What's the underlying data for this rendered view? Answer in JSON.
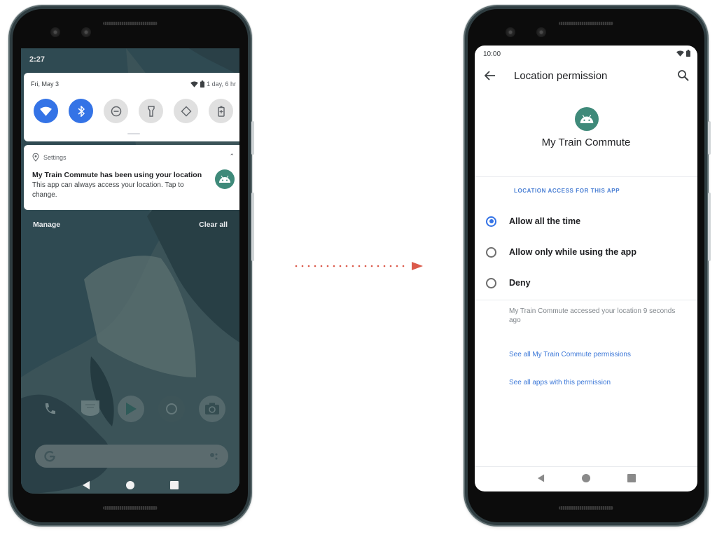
{
  "colors": {
    "accent_blue": "#3473e6",
    "link_blue": "#3c78d8",
    "app_icon_teal": "#3f8a7a",
    "arrow_red": "#db5a4b",
    "wallpaper": "#2f4a52"
  },
  "left_phone": {
    "status_time": "2:27",
    "quick_settings": {
      "date": "Fri, May 3",
      "battery_text": "1 day, 6 hr",
      "tiles": [
        {
          "icon": "wifi-icon",
          "state": "on"
        },
        {
          "icon": "bluetooth-icon",
          "state": "on"
        },
        {
          "icon": "do-not-disturb-icon",
          "state": "off"
        },
        {
          "icon": "flashlight-icon",
          "state": "off"
        },
        {
          "icon": "auto-rotate-icon",
          "state": "off"
        },
        {
          "icon": "battery-saver-icon",
          "state": "off"
        }
      ]
    },
    "notification": {
      "source": "Settings",
      "title": "My Train Commute has been using your location",
      "body": "This app can always access your location. Tap to change.",
      "icon": "android-app-icon"
    },
    "actions": {
      "manage": "Manage",
      "clear_all": "Clear all"
    },
    "dock_icons": [
      "phone-icon",
      "messages-icon",
      "play-store-icon",
      "chrome-icon",
      "camera-icon"
    ],
    "search_bar": {
      "icon_left": "google-g-icon",
      "icon_right": "assistant-icon"
    },
    "nav": [
      "back-icon",
      "home-icon",
      "recents-icon"
    ]
  },
  "right_phone": {
    "status_time": "10:00",
    "appbar": {
      "title": "Location permission",
      "back_icon": "back-arrow-icon",
      "search_icon": "search-icon"
    },
    "app_name": "My Train Commute",
    "section_label": "LOCATION ACCESS FOR THIS APP",
    "options": [
      {
        "label": "Allow all the time",
        "selected": true
      },
      {
        "label": "Allow only while using the app",
        "selected": false
      },
      {
        "label": "Deny",
        "selected": false
      }
    ],
    "access_note": "My Train Commute accessed your location 9 seconds ago",
    "links": {
      "app_permissions": "See all My Train Commute permissions",
      "apps_with_permission": "See all apps with this permission"
    },
    "nav": [
      "back-icon",
      "home-icon",
      "recents-icon"
    ]
  }
}
